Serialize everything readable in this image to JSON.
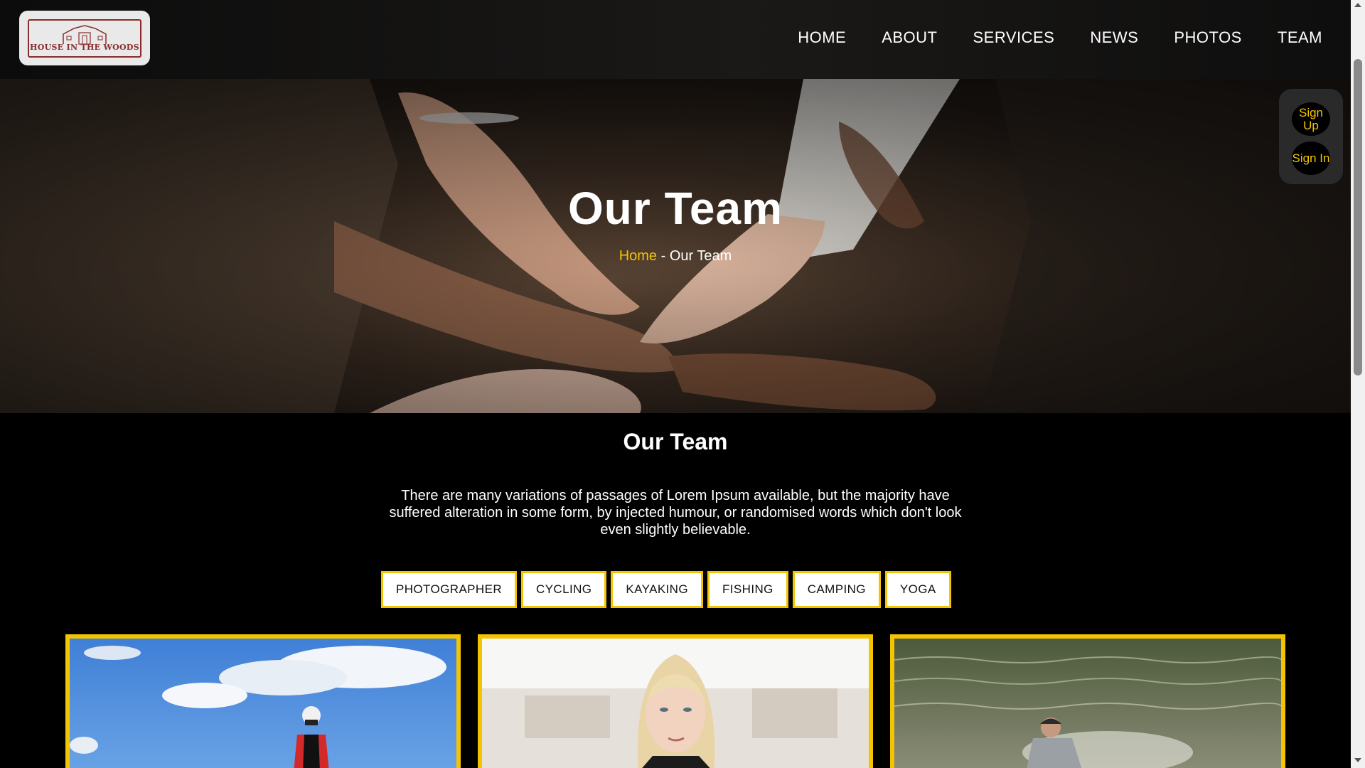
{
  "header": {
    "logo_text": "HOUSE IN THE WOODS",
    "nav": [
      {
        "label": "HOME"
      },
      {
        "label": "ABOUT"
      },
      {
        "label": "SERVICES"
      },
      {
        "label": "NEWS"
      },
      {
        "label": "PHOTOS"
      },
      {
        "label": "TEAM"
      }
    ]
  },
  "hero": {
    "title": "Our Team",
    "breadcrumb": {
      "home": "Home",
      "separator": " - ",
      "current": "Our Team"
    }
  },
  "auth": {
    "sign_up": "Sign Up",
    "sign_in": "Sign In"
  },
  "section": {
    "title": "Our Team",
    "description": "There are many variations of passages of Lorem Ipsum available, but the majority have suffered alteration in some form, by injected humour, or randomised words which don't look even slightly believable."
  },
  "filters": [
    {
      "label": "PHOTOGRAPHER"
    },
    {
      "label": "CYCLING"
    },
    {
      "label": "KAYAKING"
    },
    {
      "label": "FISHING"
    },
    {
      "label": "CAMPING"
    },
    {
      "label": "YOGA"
    }
  ],
  "colors": {
    "accent": "#f5c400",
    "background": "#000000",
    "logo_red": "#8a2a2a"
  }
}
